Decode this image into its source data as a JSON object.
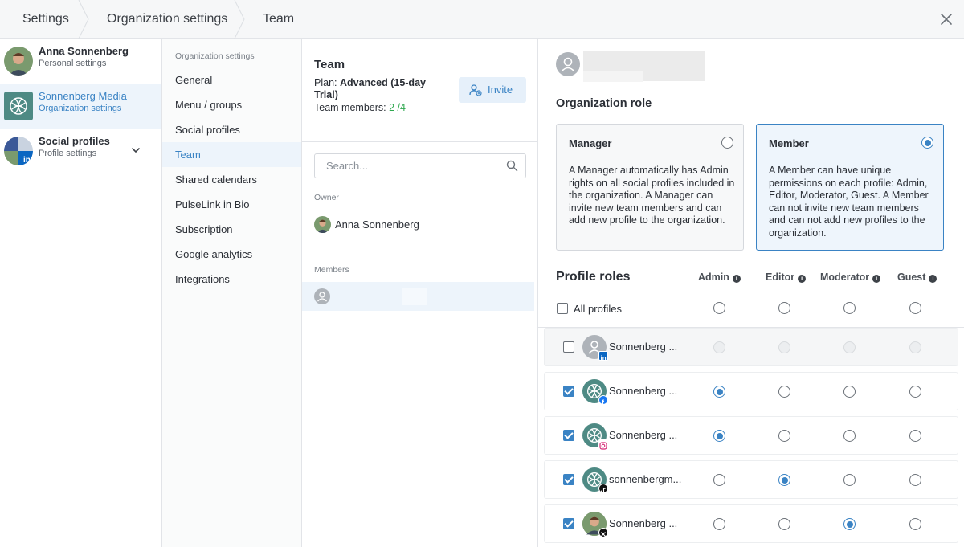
{
  "breadcrumb": [
    "Settings",
    "Organization settings",
    "Team"
  ],
  "accounts": [
    {
      "name": "Anna Sonnenberg",
      "sub": "Personal settings"
    },
    {
      "name": "Sonnenberg Media",
      "sub": "Organization settings"
    },
    {
      "name": "Social profiles",
      "sub": "Profile settings"
    }
  ],
  "org_nav": {
    "section_label": "Organization settings",
    "items": [
      "General",
      "Menu / groups",
      "Social profiles",
      "Team",
      "Shared calendars",
      "PulseLink in Bio",
      "Subscription",
      "Google analytics",
      "Integrations"
    ],
    "active": "Team"
  },
  "team": {
    "title": "Team",
    "plan_label": "Plan:",
    "plan_value": "Advanced (15-day Trial)",
    "members_label": "Team members:",
    "members_count": "2 /4",
    "invite_label": "Invite",
    "search_placeholder": "Search...",
    "owner_label": "Owner",
    "owner_name": "Anna Sonnenberg",
    "members_label_group": "Members"
  },
  "detail": {
    "org_role_title": "Organization role",
    "roles": [
      {
        "title": "Manager",
        "desc": "A Manager automatically has Admin rights on all social profiles included in the organization. A Manager can invite new team members and can add new profile to the organization.",
        "selected": false
      },
      {
        "title": "Member",
        "desc": "A Member can have unique permissions on each profile: Admin, Editor, Moderator, Guest. A Member can not invite new team members and can not add new profiles to the organization.",
        "selected": true
      }
    ],
    "profile_roles_title": "Profile roles",
    "columns": [
      "Admin",
      "Editor",
      "Moderator",
      "Guest"
    ],
    "all_profiles_label": "All profiles",
    "profiles": [
      {
        "name": "Sonnenberg ...",
        "network": "linkedin",
        "checked": false,
        "role": null,
        "disabled": true
      },
      {
        "name": "Sonnenberg ...",
        "network": "facebook",
        "checked": true,
        "role": "Admin",
        "disabled": false
      },
      {
        "name": "Sonnenberg ...",
        "network": "instagram",
        "checked": true,
        "role": "Admin",
        "disabled": false
      },
      {
        "name": "sonnenbergm...",
        "network": "tiktok",
        "checked": true,
        "role": "Editor",
        "disabled": false
      },
      {
        "name": "Sonnenberg ...",
        "network": "x",
        "checked": true,
        "role": "Moderator",
        "disabled": false
      }
    ]
  },
  "colors": {
    "accent": "#3a83c4",
    "accent_bg": "#edf4fb",
    "success": "#2fa84f"
  }
}
